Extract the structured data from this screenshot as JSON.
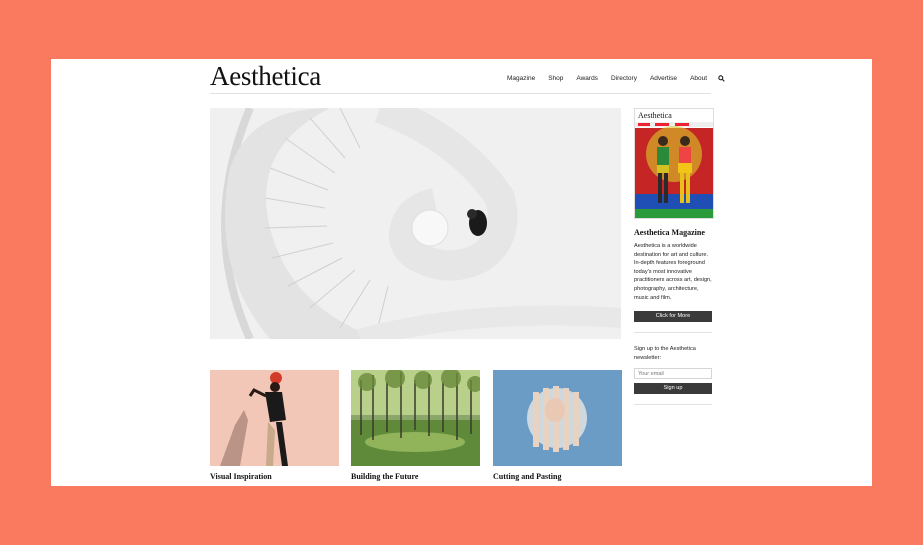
{
  "brand": {
    "logo_text": "Aesthetica"
  },
  "nav": {
    "items": [
      "Magazine",
      "Shop",
      "Awards",
      "Directory",
      "Advertise",
      "About"
    ],
    "search_icon": "search-icon"
  },
  "hero": {
    "alt_description": ""
  },
  "sidebar": {
    "magazine_title": "Aesthetica Magazine",
    "magazine_desc": "Aesthetica is a worldwide destination for art and culture. In-depth features foreground today's most innovative practitioners across art, design, photography, architecture, music and film.",
    "more_button": "Click for More",
    "newsletter_text": "Sign up to the Aesthetica newsletter:",
    "email_placeholder": "Your email",
    "signup_button": "Sign up"
  },
  "cards": [
    {
      "caption": "Visual Inspiration"
    },
    {
      "caption": "Building the Future"
    },
    {
      "caption": "Cutting and Pasting"
    }
  ],
  "colors": {
    "background": "#f97a5e",
    "dark_button": "#3a3a3a"
  }
}
